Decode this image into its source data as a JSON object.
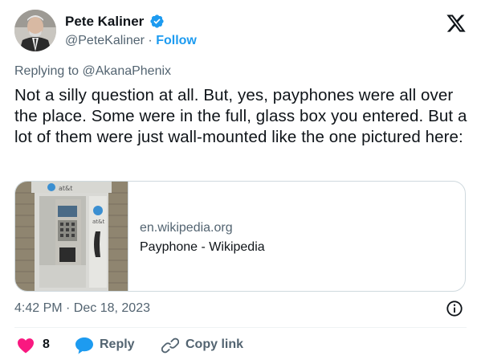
{
  "author": {
    "name": "Pete Kaliner",
    "handle": "@PeteKaliner",
    "separator": "·",
    "follow_label": "Follow"
  },
  "reply_context": {
    "prefix": "Replying to",
    "mention": "@AkanaPhenix"
  },
  "tweet_text": "Not a silly question at all. But, yes, payphones were all over the place. Some were in the full, glass box you entered. But a lot of them were just wall-mounted like the one pictured here:",
  "link_card": {
    "domain": "en.wikipedia.org",
    "title": "Payphone - Wikipedia",
    "image_text": [
      "at&t",
      "at&t"
    ]
  },
  "meta": {
    "timestamp": "4:42 PM · Dec 18, 2023"
  },
  "actions": {
    "like_count": "8",
    "reply_label": "Reply",
    "copy_link_label": "Copy link"
  },
  "colors": {
    "text": "#0f1419",
    "muted": "#536471",
    "accent": "#1d9bf0",
    "like": "#f91880",
    "border": "#cfd9de"
  },
  "icons": {
    "verified": "verified-badge-icon",
    "logo": "x-logo-icon",
    "info": "info-icon",
    "like": "heart-icon",
    "reply": "reply-bubble-icon",
    "copy": "link-icon"
  }
}
